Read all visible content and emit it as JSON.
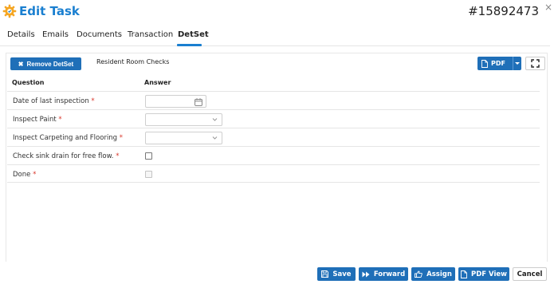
{
  "header": {
    "title": "Edit Task",
    "task_number": "#15892473",
    "close_glyph": "×",
    "icon": "gear-icon",
    "accent_color": "#1a7fd0",
    "icon_color": "#f5a623"
  },
  "tabs": [
    {
      "label": "Details"
    },
    {
      "label": "Emails"
    },
    {
      "label": "Documents"
    },
    {
      "label": "Transaction"
    },
    {
      "label": "DetSet",
      "active": true
    }
  ],
  "toolbar": {
    "remove_label": "Remove DetSet",
    "detset_name": "Resident Room Checks",
    "pdf_label": "PDF"
  },
  "table": {
    "question_header": "Question",
    "answer_header": "Answer",
    "rows": [
      {
        "question": "Date of last inspection",
        "required": "*",
        "answer_type": "date",
        "value": ""
      },
      {
        "question": "Inspect Paint",
        "required": "*",
        "answer_type": "select",
        "value": ""
      },
      {
        "question": "Inspect Carpeting and Flooring",
        "required": "*",
        "answer_type": "select",
        "value": ""
      },
      {
        "question": "Check sink drain for free flow.",
        "required": "*",
        "answer_type": "checkbox",
        "checked": false
      },
      {
        "question": "Done",
        "required": "*",
        "answer_type": "checkbox",
        "checked": false,
        "disabled": true
      }
    ]
  },
  "footer": {
    "save_label": "Save",
    "forward_label": "Forward",
    "assign_label": "Assign",
    "pdf_view_label": "PDF View",
    "cancel_label": "Cancel"
  },
  "colors": {
    "button_primary": "#1f6fb8",
    "required": "#d9372b"
  }
}
